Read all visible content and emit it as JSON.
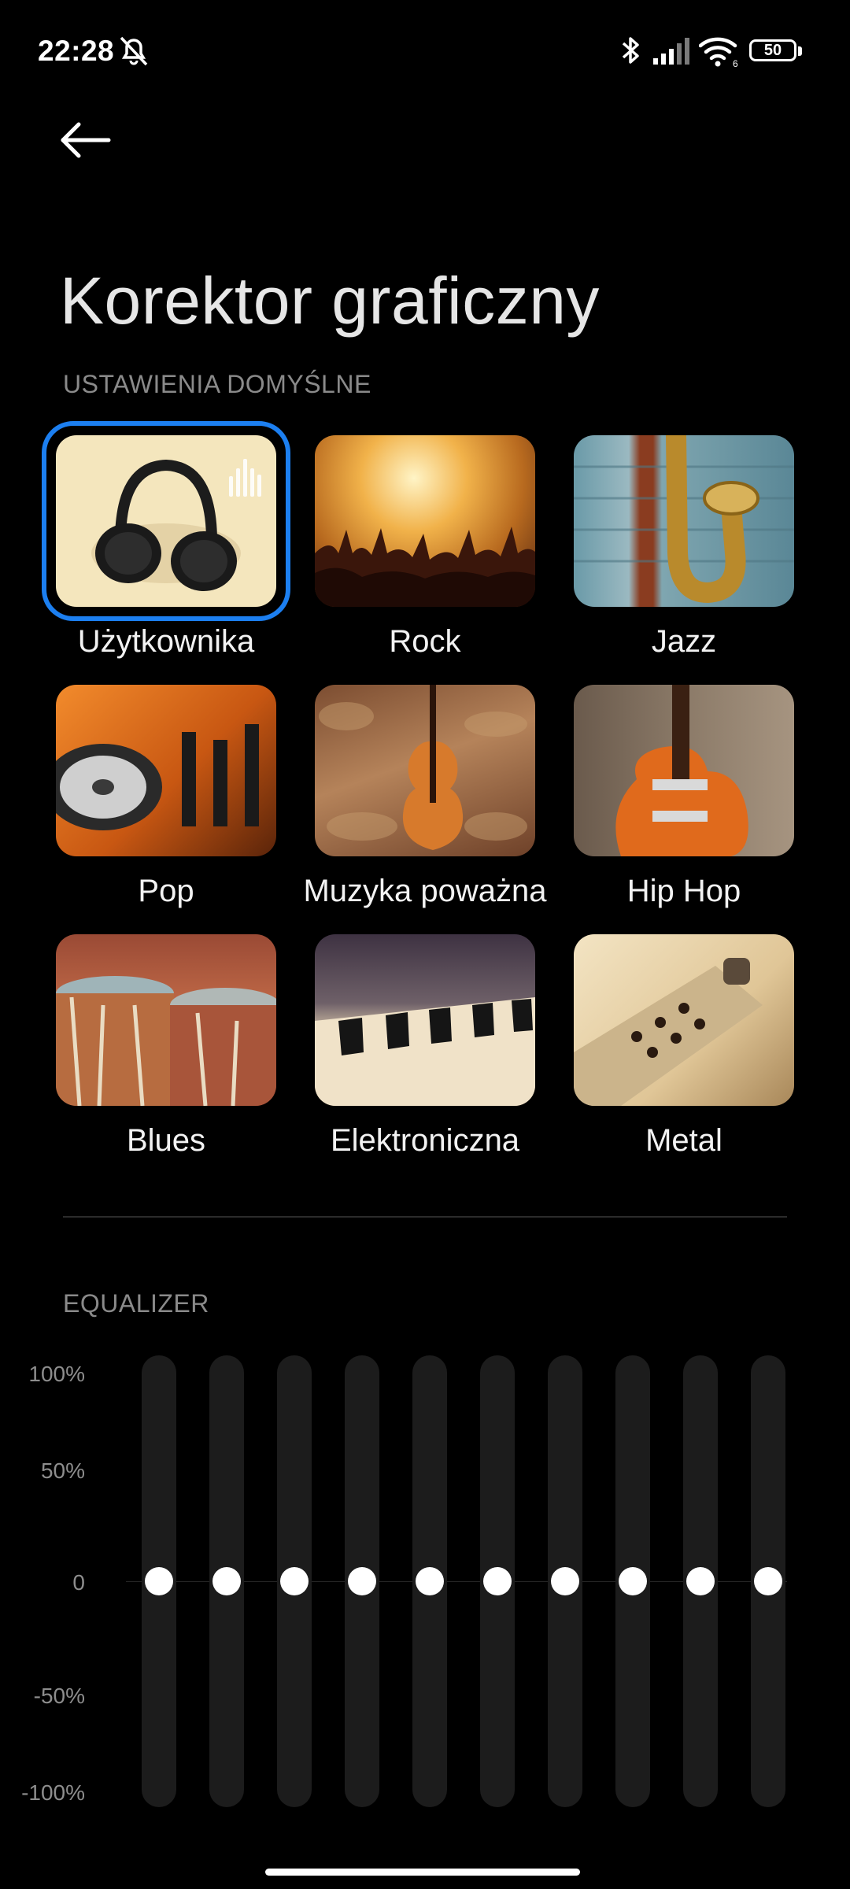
{
  "status_bar": {
    "time": "22:28",
    "battery_level": "50",
    "icons": [
      "mute-bell-icon",
      "bluetooth-icon",
      "signal-icon",
      "wifi-icon",
      "battery-icon"
    ],
    "wifi_badge": "6"
  },
  "header": {
    "title": "Korektor graficzny",
    "back_icon": "back-arrow-icon"
  },
  "presets_section": {
    "label": "USTAWIENIA DOMYŚLNE",
    "selected": "Użytkownika",
    "items": [
      {
        "label": "Użytkownika",
        "image": "headphones"
      },
      {
        "label": "Rock",
        "image": "concert-crowd"
      },
      {
        "label": "Jazz",
        "image": "saxophone"
      },
      {
        "label": "Pop",
        "image": "dj-turntable"
      },
      {
        "label": "Muzyka poważna",
        "image": "violin"
      },
      {
        "label": "Hip Hop",
        "image": "electric-guitar"
      },
      {
        "label": "Blues",
        "image": "drums"
      },
      {
        "label": "Elektroniczna",
        "image": "piano-keys"
      },
      {
        "label": "Metal",
        "image": "guitar-body"
      }
    ]
  },
  "equalizer": {
    "label": "EQUALIZER",
    "scale": [
      "100%",
      "50%",
      "0",
      "-50%",
      "-100%"
    ],
    "band_count": 10,
    "band_values_percent": [
      0,
      0,
      0,
      0,
      0,
      0,
      0,
      0,
      0,
      0
    ]
  },
  "colors": {
    "accent": "#1c7ff0",
    "background": "#000000",
    "track": "#1c1c1c"
  }
}
